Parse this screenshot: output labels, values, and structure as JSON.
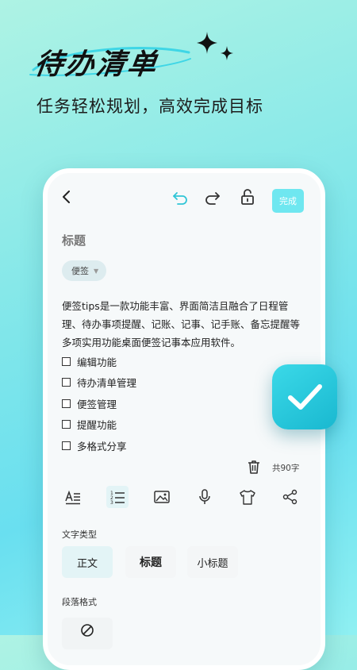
{
  "hero": {
    "title": "待办清单",
    "subtitle": "任务轻松规划，高效完成目标"
  },
  "toolbar": {
    "back_icon": "back-arrow-icon",
    "undo_icon": "undo-icon",
    "redo_icon": "redo-icon",
    "lock_icon": "unlock-icon",
    "done_label": "完成"
  },
  "note": {
    "title_placeholder": "标题",
    "tag_label": "便签",
    "body": "便签tips是一款功能丰富、界面简洁且融合了日程管理、待办事项提醒、记账、记事、记手账、备忘提醒等多项实用功能桌面便签记事本应用软件。",
    "checklist": [
      {
        "label": "编辑功能",
        "checked": false
      },
      {
        "label": "待办清单管理",
        "checked": false
      },
      {
        "label": "便签管理",
        "checked": false
      },
      {
        "label": "提醒功能",
        "checked": false
      },
      {
        "label": "多格式分享",
        "checked": false
      }
    ],
    "word_count": "共90字"
  },
  "format_bar": {
    "icons": [
      "text-style-icon",
      "numbered-list-icon",
      "image-icon",
      "microphone-icon",
      "shirt-icon",
      "share-icon"
    ],
    "active_index": 1
  },
  "text_type": {
    "label": "文字类型",
    "options": [
      "正文",
      "标题",
      "小标题"
    ],
    "selected": 0
  },
  "paragraph": {
    "label": "段落格式"
  },
  "colors": {
    "accent": "#6fe7f0",
    "badge": "#19b8d0"
  }
}
